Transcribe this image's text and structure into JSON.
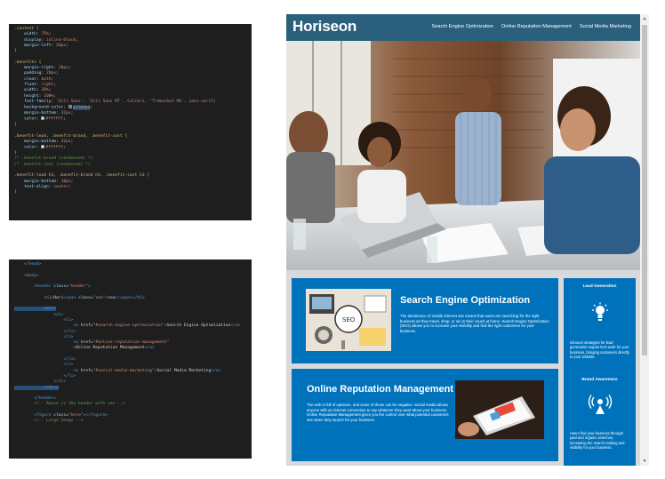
{
  "css_editor": {
    "lines": [
      [
        {
          "c": "sel",
          "t": ".content {"
        }
      ],
      [
        {
          "c": "prop",
          "t": "    width"
        },
        {
          "c": "punc",
          "t": ": "
        },
        {
          "c": "val",
          "t": "75%"
        },
        {
          "c": "punc",
          "t": ";"
        }
      ],
      [
        {
          "c": "prop",
          "t": "    display"
        },
        {
          "c": "punc",
          "t": ": "
        },
        {
          "c": "val",
          "t": "inline-block"
        },
        {
          "c": "punc",
          "t": ";"
        }
      ],
      [
        {
          "c": "prop",
          "t": "    margin-left"
        },
        {
          "c": "punc",
          "t": ": "
        },
        {
          "c": "val",
          "t": "20px"
        },
        {
          "c": "punc",
          "t": ";"
        }
      ],
      [
        {
          "c": "sel",
          "t": "}"
        }
      ],
      [
        {
          "c": "txt",
          "t": ""
        }
      ],
      [
        {
          "c": "sel",
          "t": ".benefits {"
        }
      ],
      [
        {
          "c": "prop",
          "t": "    margin-right"
        },
        {
          "c": "punc",
          "t": ": "
        },
        {
          "c": "val",
          "t": "20px"
        },
        {
          "c": "punc",
          "t": ";"
        }
      ],
      [
        {
          "c": "prop",
          "t": "    padding"
        },
        {
          "c": "punc",
          "t": ": "
        },
        {
          "c": "val",
          "t": "20px"
        },
        {
          "c": "punc",
          "t": ";"
        }
      ],
      [
        {
          "c": "prop",
          "t": "    clear"
        },
        {
          "c": "punc",
          "t": ": "
        },
        {
          "c": "val",
          "t": "both"
        },
        {
          "c": "punc",
          "t": ";"
        }
      ],
      [
        {
          "c": "prop",
          "t": "    float"
        },
        {
          "c": "punc",
          "t": ": "
        },
        {
          "c": "val",
          "t": "right"
        },
        {
          "c": "punc",
          "t": ";"
        }
      ],
      [
        {
          "c": "prop",
          "t": "    width"
        },
        {
          "c": "punc",
          "t": ": "
        },
        {
          "c": "val",
          "t": "20%"
        },
        {
          "c": "punc",
          "t": ";"
        }
      ],
      [
        {
          "c": "prop",
          "t": "    height"
        },
        {
          "c": "punc",
          "t": ": "
        },
        {
          "c": "val",
          "t": "100%"
        },
        {
          "c": "punc",
          "t": ";"
        }
      ],
      [
        {
          "c": "prop",
          "t": "    font-family"
        },
        {
          "c": "punc",
          "t": ": "
        },
        {
          "c": "val",
          "t": "'Gill Sans', 'Gill Sans MT', Calibri, 'Trebuchet MS', sans-serif"
        },
        {
          "c": "punc",
          "t": ";"
        }
      ],
      [
        {
          "c": "prop",
          "t": "    background-color"
        },
        {
          "c": "punc",
          "t": ": "
        },
        {
          "c": "swatch",
          "t": "#2589bd"
        },
        {
          "c": "val hl",
          "t": "#2589bd"
        },
        {
          "c": "punc",
          "t": ";"
        }
      ],
      [
        {
          "c": "prop",
          "t": "    margin-bottom"
        },
        {
          "c": "punc",
          "t": ": "
        },
        {
          "c": "val",
          "t": "32px"
        },
        {
          "c": "punc",
          "t": ";"
        }
      ],
      [
        {
          "c": "prop",
          "t": "    color"
        },
        {
          "c": "punc",
          "t": ": "
        },
        {
          "c": "swatch",
          "t": "#ffffff"
        },
        {
          "c": "val",
          "t": "#ffffff"
        },
        {
          "c": "punc",
          "t": ";"
        }
      ],
      [
        {
          "c": "sel",
          "t": "}"
        }
      ],
      [
        {
          "c": "txt",
          "t": ""
        }
      ],
      [
        {
          "c": "sel",
          "t": ".benefit-lead, .benefit-brand, .benefit-cost {"
        }
      ],
      [
        {
          "c": "prop",
          "t": "    margin-bottom"
        },
        {
          "c": "punc",
          "t": ": "
        },
        {
          "c": "val",
          "t": "32px"
        },
        {
          "c": "punc",
          "t": ";"
        }
      ],
      [
        {
          "c": "prop",
          "t": "    color"
        },
        {
          "c": "punc",
          "t": ": "
        },
        {
          "c": "swatch",
          "t": "#ffffff"
        },
        {
          "c": "val",
          "t": "#ffffff"
        },
        {
          "c": "punc",
          "t": ";"
        }
      ],
      [
        {
          "c": "sel",
          "t": "}"
        }
      ],
      [
        {
          "c": "comm",
          "t": "/* .benefit-brand (condensed) */"
        }
      ],
      [
        {
          "c": "comm",
          "t": "/* .benefit-cost (condensed) */"
        }
      ],
      [
        {
          "c": "txt",
          "t": ""
        }
      ],
      [
        {
          "c": "sel",
          "t": ".benefit-lead h3, .benefit-brand h3, .benefit-cost h3 {"
        }
      ],
      [
        {
          "c": "prop",
          "t": "    margin-bottom"
        },
        {
          "c": "punc",
          "t": ": "
        },
        {
          "c": "val",
          "t": "10px"
        },
        {
          "c": "punc",
          "t": ";"
        }
      ],
      [
        {
          "c": "prop",
          "t": "    text-align"
        },
        {
          "c": "punc",
          "t": ": "
        },
        {
          "c": "val",
          "t": "center"
        },
        {
          "c": "punc",
          "t": ";"
        }
      ],
      [
        {
          "c": "sel",
          "t": "}"
        }
      ]
    ]
  },
  "html_editor": {
    "lines": [
      [
        {
          "c": "tag",
          "t": "    </head>"
        }
      ],
      [
        {
          "c": "txt",
          "t": ""
        }
      ],
      [
        {
          "c": "tag",
          "t": "    <body>"
        }
      ],
      [
        {
          "c": "txt",
          "t": ""
        }
      ],
      [
        {
          "c": "tag",
          "t": "        <header "
        },
        {
          "c": "attr",
          "t": "class"
        },
        {
          "c": "punc",
          "t": "="
        },
        {
          "c": "str",
          "t": "\"header\""
        },
        {
          "c": "tag",
          "t": ">"
        }
      ],
      [
        {
          "c": "txt",
          "t": ""
        }
      ],
      [
        {
          "c": "tag",
          "t": "            <h1>"
        },
        {
          "c": "txt",
          "t": "Hori"
        },
        {
          "c": "tag",
          "t": "<span "
        },
        {
          "c": "attr",
          "t": "class"
        },
        {
          "c": "punc",
          "t": "="
        },
        {
          "c": "str",
          "t": "\"seo\""
        },
        {
          "c": "tag",
          "t": ">"
        },
        {
          "c": "txt",
          "t": "seo"
        },
        {
          "c": "tag",
          "t": "</span></h1>"
        }
      ],
      [
        {
          "c": "txt",
          "t": ""
        }
      ],
      [
        {
          "c": "tag hl",
          "t": "            <div>"
        }
      ],
      [
        {
          "c": "tag",
          "t": "                <ul>"
        }
      ],
      [
        {
          "c": "tag",
          "t": "                    <li>"
        }
      ],
      [
        {
          "c": "tag",
          "t": "                        <a "
        },
        {
          "c": "attr",
          "t": "href"
        },
        {
          "c": "punc",
          "t": "="
        },
        {
          "c": "str",
          "t": "\"#search-engine-optimization\""
        },
        {
          "c": "tag",
          "t": ">"
        },
        {
          "c": "txt",
          "t": "Search Engine Optimization"
        },
        {
          "c": "tag",
          "t": "</a>"
        }
      ],
      [
        {
          "c": "tag",
          "t": "                    </li>"
        }
      ],
      [
        {
          "c": "tag",
          "t": "                    <li>"
        }
      ],
      [
        {
          "c": "tag",
          "t": "                        <a "
        },
        {
          "c": "attr",
          "t": "href"
        },
        {
          "c": "punc",
          "t": "="
        },
        {
          "c": "str",
          "t": "\"#online-reputation-management\""
        }
      ],
      [
        {
          "c": "tag",
          "t": "                        >"
        },
        {
          "c": "txt",
          "t": "Online Reputation Management"
        },
        {
          "c": "tag",
          "t": "</a>"
        }
      ],
      [
        {
          "c": "txt",
          "t": ""
        }
      ],
      [
        {
          "c": "tag",
          "t": "                    </li>"
        }
      ],
      [
        {
          "c": "tag",
          "t": "                    <li>"
        }
      ],
      [
        {
          "c": "tag",
          "t": "                        <a "
        },
        {
          "c": "attr",
          "t": "href"
        },
        {
          "c": "punc",
          "t": "="
        },
        {
          "c": "str",
          "t": "\"#social-media-marketing\""
        },
        {
          "c": "tag",
          "t": ">"
        },
        {
          "c": "txt",
          "t": "Social Media Marketing"
        },
        {
          "c": "tag",
          "t": "</a>"
        }
      ],
      [
        {
          "c": "tag",
          "t": "                    </li>"
        }
      ],
      [
        {
          "c": "tag",
          "t": "                </ul>"
        }
      ],
      [
        {
          "c": "tag hl",
          "t": "            </div>"
        }
      ],
      [
        {
          "c": "txt",
          "t": ""
        }
      ],
      [
        {
          "c": "tag",
          "t": "        </header>"
        }
      ],
      [
        {
          "c": "comm",
          "t": "        <!-- Above is the header with nav -->"
        }
      ],
      [
        {
          "c": "txt",
          "t": ""
        }
      ],
      [
        {
          "c": "tag",
          "t": "        <figure "
        },
        {
          "c": "attr",
          "t": "class"
        },
        {
          "c": "punc",
          "t": "="
        },
        {
          "c": "str",
          "t": "\"hero\""
        },
        {
          "c": "tag",
          "t": "></figure>"
        }
      ],
      [
        {
          "c": "comm",
          "t": "        <!-- Large Image -->"
        }
      ]
    ]
  },
  "site": {
    "logo": "Horiseon",
    "nav": [
      {
        "label": "Search Engine Optimization"
      },
      {
        "label": "Online Reputation Management"
      },
      {
        "label": "Social Media Marketing"
      }
    ],
    "articles": {
      "seo": {
        "title": "Search Engine Optimization",
        "text": "The dominance of mobile internet use means that users are searching for the right business as they travel, shop, or sit on their couch at home. Search Engine Optimization (SEO) allows you to increase your visibility and find the right customers for your business."
      },
      "orm": {
        "title": "Online Reputation Management",
        "text": "The web is full of opinions, and some of those can be negative. Social media allows anyone with an internet connection to say whatever they want about your business. Online Reputation Management gives you the control over what potential customers see when they search for your business."
      }
    },
    "benefits": {
      "lead": {
        "title": "Lead Generation",
        "text": "Inbound strategies for lead generation require less work for your business, bringing customers directly to your website."
      },
      "brand": {
        "title": "Brand Awareness",
        "text": "Users find your business through paid and organic searches, increasing the search ranking and visibility for your business."
      }
    }
  },
  "colors": {
    "editor_bg": "#1e1e1e",
    "header_bg": "#2a607c",
    "section_blue": "#0072bb"
  }
}
